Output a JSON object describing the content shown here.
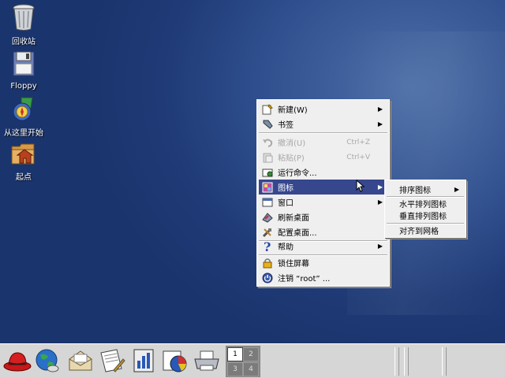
{
  "desktop": {
    "icons": [
      {
        "label": "回收站",
        "icon": "trash-icon"
      },
      {
        "label": "Floppy",
        "icon": "floppy-icon"
      },
      {
        "label": "从这里开始",
        "icon": "start-here-icon"
      },
      {
        "label": "起点",
        "icon": "home-folder-icon"
      }
    ]
  },
  "context_menu": {
    "items": [
      {
        "label": "新建(W)",
        "shortcut": "",
        "submenu": true,
        "disabled": false
      },
      {
        "label": "书签",
        "shortcut": "",
        "submenu": true,
        "disabled": false
      },
      {
        "label": "撤消(U)",
        "shortcut": "Ctrl+Z",
        "submenu": false,
        "disabled": true
      },
      {
        "label": "粘贴(P)",
        "shortcut": "Ctrl+V",
        "submenu": false,
        "disabled": true
      },
      {
        "label": "运行命令...",
        "shortcut": "",
        "submenu": false,
        "disabled": false
      },
      {
        "label": "图标",
        "shortcut": "",
        "submenu": true,
        "disabled": false,
        "selected": true
      },
      {
        "label": "窗口",
        "shortcut": "",
        "submenu": true,
        "disabled": false
      },
      {
        "label": "刷新桌面",
        "shortcut": "",
        "submenu": false,
        "disabled": false
      },
      {
        "label": "配置桌面...",
        "shortcut": "",
        "submenu": false,
        "disabled": false
      },
      {
        "label": "帮助",
        "shortcut": "",
        "submenu": true,
        "disabled": false
      },
      {
        "label": "锁住屏幕",
        "shortcut": "",
        "submenu": false,
        "disabled": false
      },
      {
        "label": "注销 “root” ...",
        "shortcut": "",
        "submenu": false,
        "disabled": false
      }
    ]
  },
  "icons_submenu": {
    "items": [
      {
        "label": "排序图标",
        "submenu": true
      },
      {
        "label": "水平排列图标",
        "submenu": false
      },
      {
        "label": "垂直排列图标",
        "submenu": false
      },
      {
        "label": "对齐到网格",
        "submenu": false
      }
    ]
  },
  "taskbar": {
    "launchers": [
      "redhat-menu-icon",
      "web-browser-icon",
      "mail-icon",
      "writer-icon",
      "presentation-icon",
      "spreadsheet-icon",
      "printer-icon"
    ],
    "workspaces": [
      "1",
      "2",
      "3",
      "4"
    ],
    "active_workspace": "1"
  },
  "colors": {
    "desktop_bg": "#2a4a8a",
    "menu_bg": "#efefef",
    "menu_selected": "#36478e"
  }
}
